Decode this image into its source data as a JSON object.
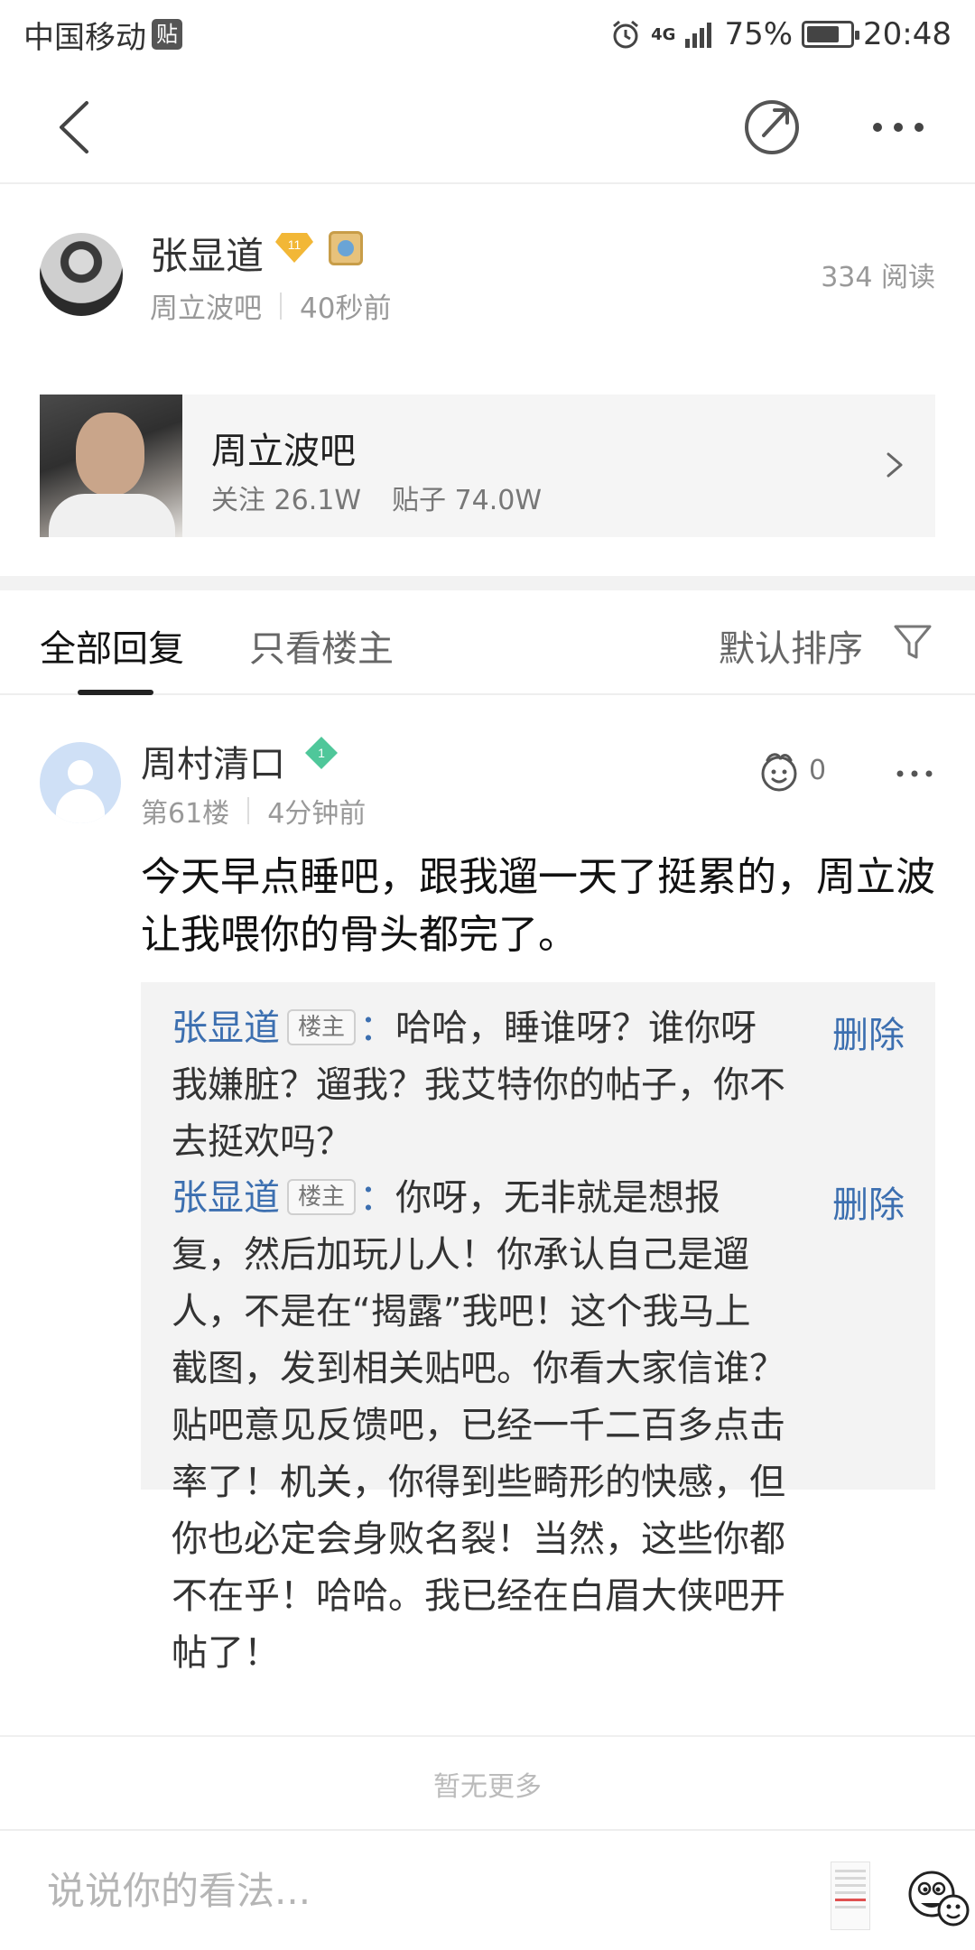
{
  "status_bar": {
    "carrier": "中国移动",
    "carrier_badge": "贴",
    "network": "4G",
    "battery": "75%",
    "battery_level": 0.75,
    "time": "20:48"
  },
  "nav": {
    "back_icon": "chevron-left-icon",
    "share_icon": "share-icon",
    "more_icon": "more-dots-icon"
  },
  "post_author": {
    "name": "张显道",
    "level": "11",
    "forum": "周立波吧",
    "time": "40秒前",
    "read_count": "334 阅读"
  },
  "forum_card": {
    "name": "周立波吧",
    "followers": "关注 26.1W",
    "posts": "贴子 74.0W"
  },
  "tabs": {
    "all_replies": "全部回复",
    "only_owner": "只看楼主",
    "sort": "默认排序"
  },
  "reply": {
    "user": "周村清口",
    "level": "1",
    "floor": "第61楼",
    "time": "4分钟前",
    "likes": "0",
    "text": "今天早点睡吧，跟我遛一天了挺累的，周立波让我喂你的骨头都完了。",
    "sub_replies": [
      {
        "user": "张显道",
        "tag": "楼主",
        "colon": "：",
        "text": "哈哈，睡谁呀？谁你呀我嫌脏？遛我？我艾特你的帖子，你不去挺欢吗？",
        "action": "删除"
      },
      {
        "user": "张显道",
        "tag": "楼主",
        "colon": "：",
        "text": "你呀，无非就是想报复，然后加玩儿人！你承认自己是遛人，不是在“揭露”我吧！这个我马上截图，发到相关贴吧。你看大家信谁？贴吧意见反馈吧，已经一千二百多点击率了！机关，你得到些畸形的快感，但你也必定会身败名裂！当然，这些你都不在乎！哈哈。我已经在白眉大侠吧开帖了！",
        "action": "删除"
      }
    ]
  },
  "footer": {
    "no_more": "暂无更多",
    "comment_placeholder": "说说你的看法..."
  },
  "colors": {
    "link_blue": "#3c6fb0",
    "level_badge_gold": "#f2b736",
    "level_badge_green": "#4fc79a"
  }
}
